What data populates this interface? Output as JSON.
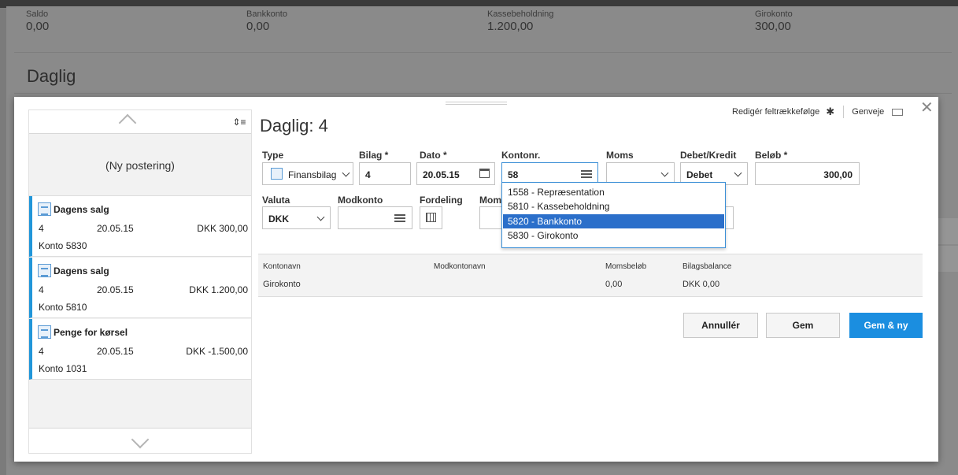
{
  "background": {
    "stats": [
      {
        "label": "Saldo",
        "value": "0,00"
      },
      {
        "label": "Bankkonto",
        "value": "0,00"
      },
      {
        "label": "Kassebeholdning",
        "value": "1.200,00"
      },
      {
        "label": "Girokonto",
        "value": "300,00"
      }
    ],
    "title": "Daglig"
  },
  "modal": {
    "title": "Daglig: 4",
    "edit_order_label": "Redigér feltrækkefølge",
    "shortcuts_label": "Genveje",
    "close_label": "✕"
  },
  "list": {
    "new_entry_label": "(Ny postering)",
    "sort_icon": "⇕≡",
    "entries": [
      {
        "title": "Dagens salg",
        "number": "4",
        "date": "20.05.15",
        "amount": "DKK 300,00",
        "account": "Konto 5830"
      },
      {
        "title": "Dagens salg",
        "number": "4",
        "date": "20.05.15",
        "amount": "DKK 1.200,00",
        "account": "Konto 5810"
      },
      {
        "title": "Penge for kørsel",
        "number": "4",
        "date": "20.05.15",
        "amount": "DKK -1.500,00",
        "account": "Konto 1031"
      }
    ]
  },
  "form": {
    "type_label": "Type",
    "type_value": "Finansbilag",
    "bilag_label": "Bilag *",
    "bilag_value": "4",
    "dato_label": "Dato *",
    "dato_value": "20.05.15",
    "konto_label": "Kontonr.",
    "konto_value": "58",
    "moms_label": "Moms",
    "moms_value": "",
    "debetkredit_label": "Debet/Kredit",
    "debetkredit_value": "Debet",
    "belob_label": "Beløb *",
    "belob_value": "300,00",
    "valuta_label": "Valuta",
    "valuta_value": "DKK",
    "modkonto_label": "Modkonto",
    "modkonto_value": "",
    "fordeling_label": "Fordeling",
    "moms2_label": "Moms"
  },
  "dropdown": {
    "items": [
      "1558 - Repræsentation",
      "5810 - Kassebeholdning",
      "5820 - Bankkonto",
      "5830 - Girokonto"
    ],
    "selected_index": 2
  },
  "summary": {
    "headers": [
      "Kontonavn",
      "Modkontonavn",
      "Momsbeløb",
      "Bilagsbalance"
    ],
    "values": [
      "Girokonto",
      "",
      "0,00",
      "DKK 0,00"
    ]
  },
  "buttons": {
    "cancel": "Annullér",
    "save": "Gem",
    "save_new": "Gem & ny"
  },
  "colors": {
    "accent": "#1b8ee0",
    "selection": "#2b6fca",
    "entry_marker": "#2196d9"
  }
}
